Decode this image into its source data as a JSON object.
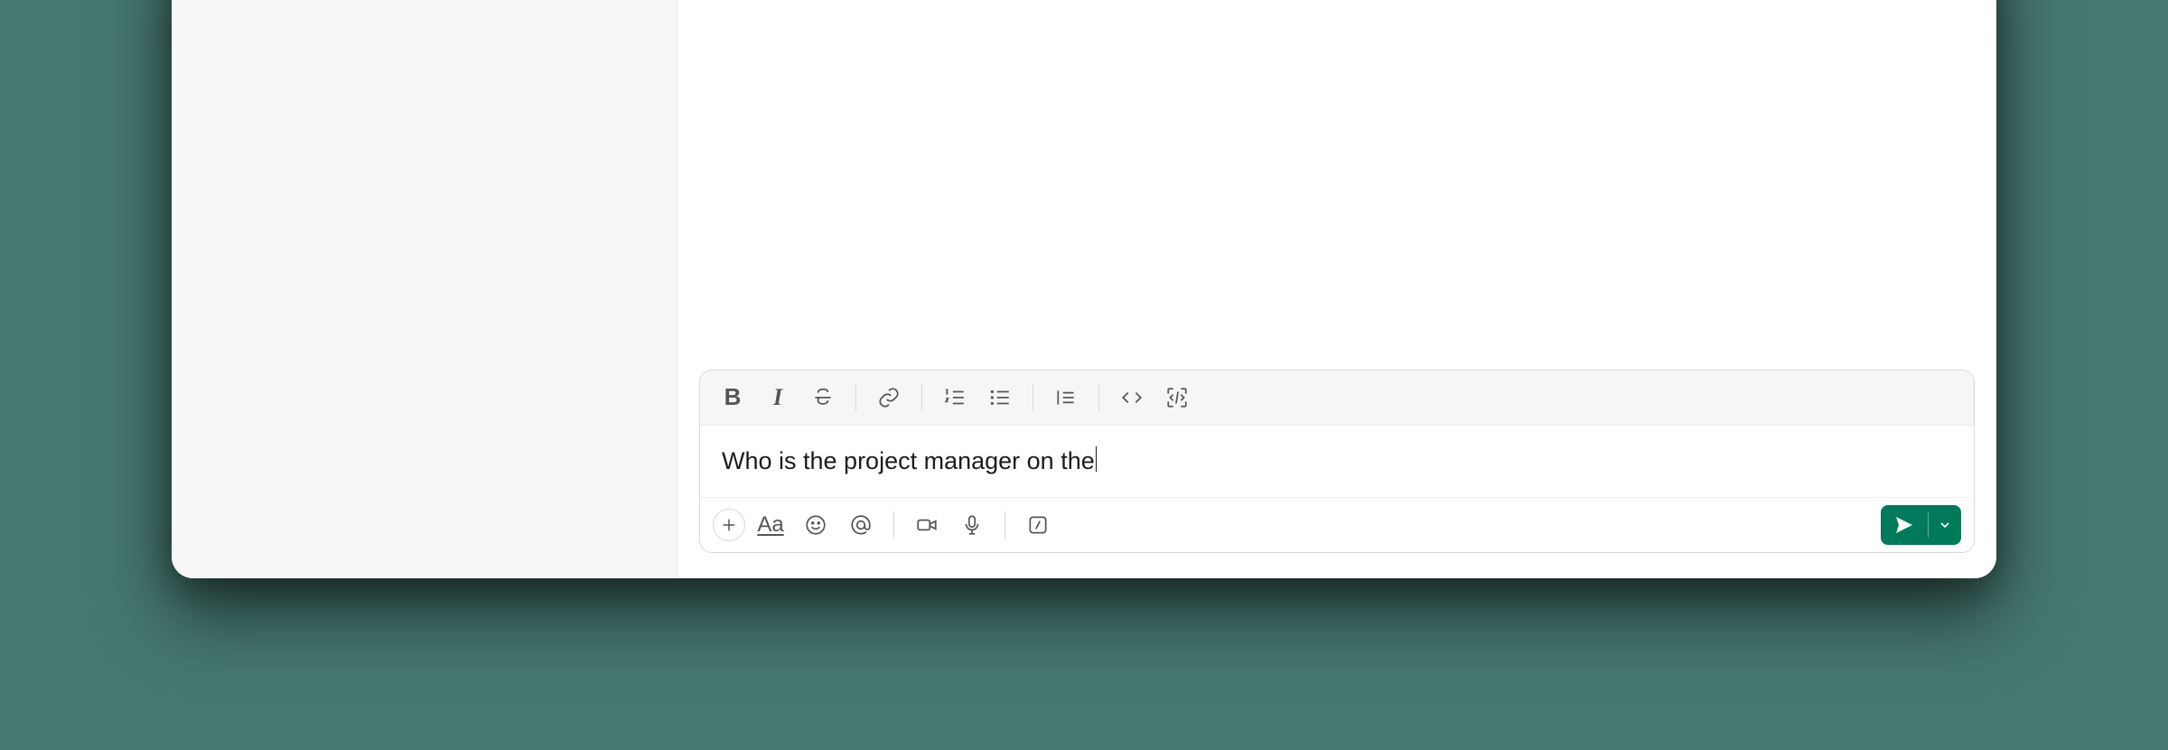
{
  "composer": {
    "message_text": "Who is the project manager on the",
    "send_color": "#007a5a"
  },
  "toolbar_top": {
    "bold": "B",
    "italic": "I"
  },
  "toolbar_bottom": {
    "text_style": "Aa"
  }
}
